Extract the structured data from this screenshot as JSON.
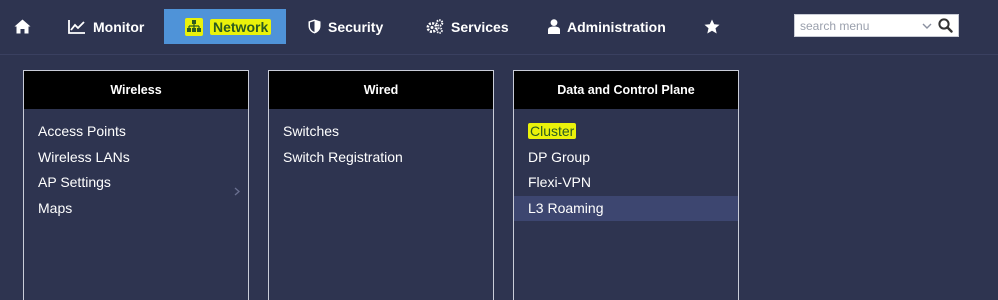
{
  "topnav": {
    "items": [
      {
        "label": "",
        "icon": "home-icon"
      },
      {
        "label": "Monitor",
        "icon": "line-chart-icon"
      },
      {
        "label": "Network",
        "icon": "sitemap-icon",
        "active": true
      },
      {
        "label": "Security",
        "icon": "shield-icon"
      },
      {
        "label": "Services",
        "icon": "gears-icon"
      },
      {
        "label": "Administration",
        "icon": "user-icon"
      },
      {
        "label": "",
        "icon": "star-icon"
      }
    ]
  },
  "search": {
    "placeholder": "search menu"
  },
  "columns": [
    {
      "header": "Wireless",
      "items": [
        "Access Points",
        "Wireless LANs",
        "AP Settings",
        "Maps"
      ]
    },
    {
      "header": "Wired",
      "items": [
        "Switches",
        "Switch Registration"
      ]
    },
    {
      "header": "Data and Control Plane",
      "items": [
        "Cluster",
        "DP Group",
        "Flexi-VPN",
        "L3 Roaming"
      ]
    }
  ],
  "colors": {
    "background": "#2e3450",
    "active_tab": "#4f93d8",
    "highlight": "#eaf20a",
    "column_header": "#000000",
    "selected_row": "#3d4670"
  }
}
